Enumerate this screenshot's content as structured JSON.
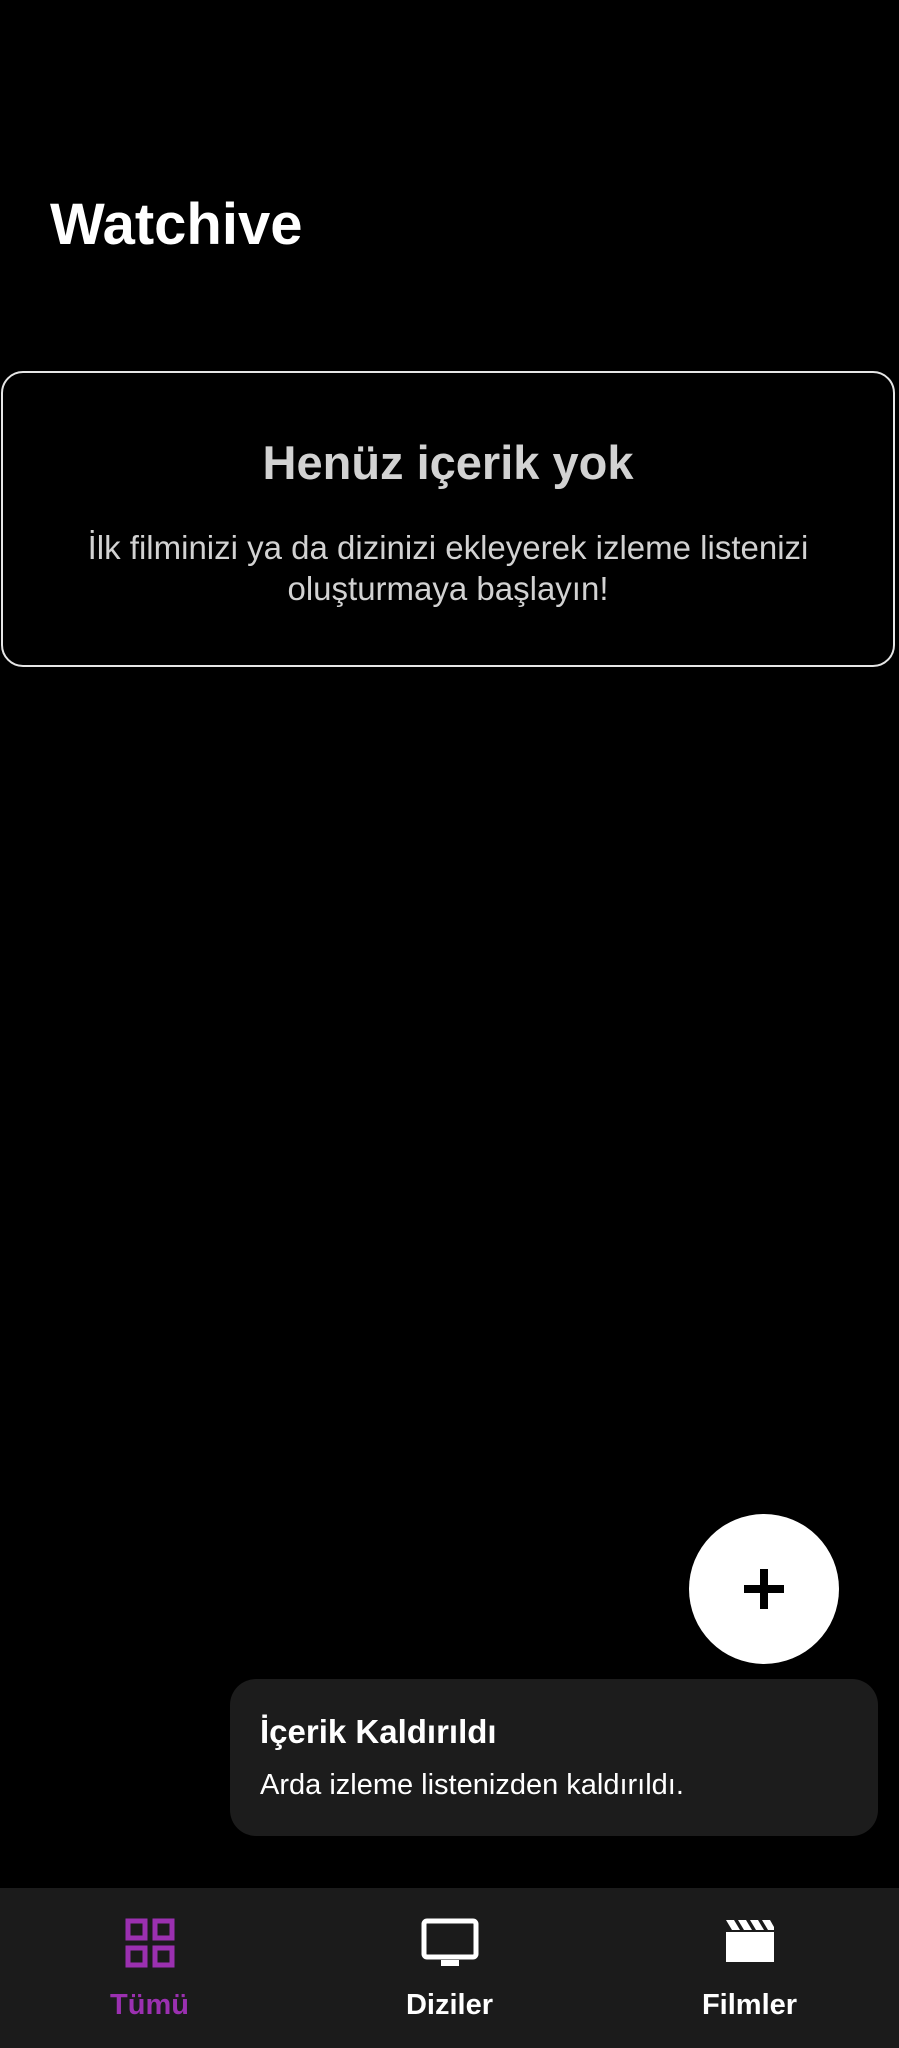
{
  "app": {
    "title": "Watchive"
  },
  "empty_state": {
    "title": "Henüz içerik yok",
    "message": "İlk filminizi ya da dizinizi ekleyerek izleme listenizi oluşturmaya başlayın!"
  },
  "fab": {
    "icon": "plus-icon"
  },
  "snackbar": {
    "title": "İçerik Kaldırıldı",
    "message": "Arda izleme listenizden kaldırıldı."
  },
  "bottom_nav": {
    "items": [
      {
        "label": "Tümü",
        "icon": "grid-icon",
        "active": true
      },
      {
        "label": "Diziler",
        "icon": "tv-icon",
        "active": false
      },
      {
        "label": "Filmler",
        "icon": "clapperboard-icon",
        "active": false
      }
    ]
  },
  "colors": {
    "background": "#000000",
    "accent": "#9b30b0",
    "nav_background": "#1b1b1b",
    "snackbar_background": "#1c1c1c",
    "card_border": "#e6e6e6",
    "muted_text": "#d2d2d2"
  }
}
